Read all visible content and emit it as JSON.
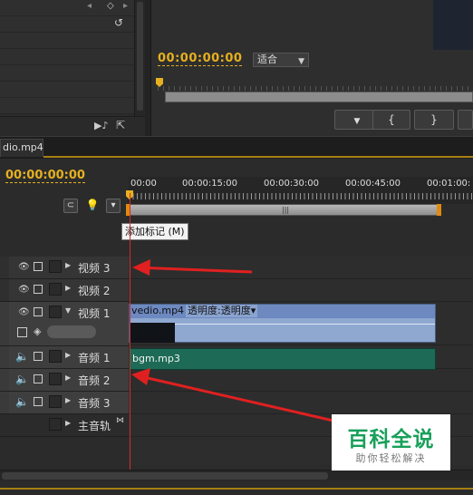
{
  "monitor": {
    "timecode": "00:00:00:00",
    "fit_value": "适合",
    "buttons": [
      "▼",
      "{",
      "}",
      ""
    ]
  },
  "sequence_tab": {
    "label": "dio.mp4"
  },
  "timeline": {
    "timecode": "00:00:00:00",
    "ruler_labels": [
      "00:00",
      "00:00:15:00",
      "00:00:30:00",
      "00:00:45:00",
      "00:01:00:"
    ],
    "tooltip": "添加标记 (M)"
  },
  "tracks": {
    "video": [
      "视频 3",
      "视频 2",
      "视频 1"
    ],
    "audio": [
      "音频 1",
      "音频 2",
      "音频 3"
    ],
    "master": "主音轨"
  },
  "clips": {
    "video_clip_name": "vedio.mp4",
    "video_clip_effect": "透明度:透明度▾",
    "audio_clip_name": "bgm.mp3"
  },
  "watermark": {
    "title": "百科全说",
    "subtitle": "助你轻松解决"
  },
  "colors": {
    "timecode": "#e6b020",
    "playhead": "#d42b2b",
    "video_clip": "#8fa8d0",
    "audio_clip": "#1d6b56",
    "annotation_arrow": "#e02020"
  }
}
